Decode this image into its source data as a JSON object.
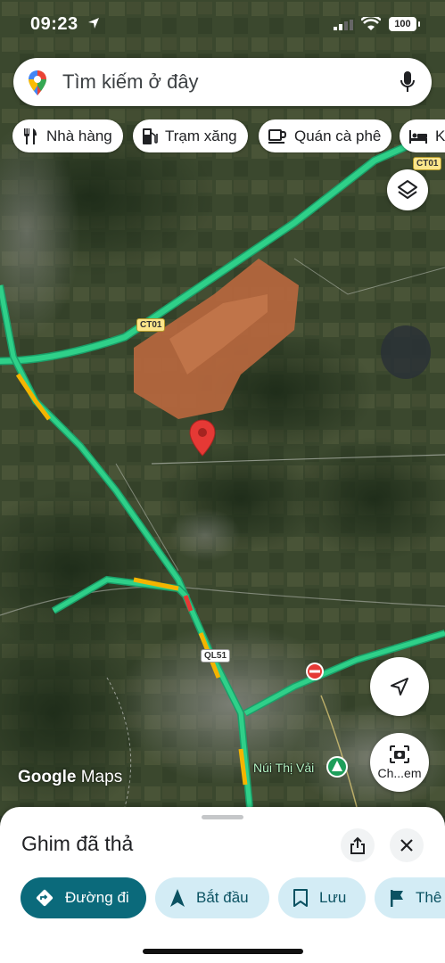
{
  "status_bar": {
    "time": "09:23",
    "battery": "100"
  },
  "search": {
    "placeholder": "Tìm kiếm ở đây"
  },
  "chips": [
    {
      "label": "Nhà hàng",
      "icon": "restaurant-icon"
    },
    {
      "label": "Trạm xăng",
      "icon": "gas-station-icon"
    },
    {
      "label": "Quán cà phê",
      "icon": "coffee-icon"
    },
    {
      "label": "Kh",
      "icon": "hotel-icon"
    }
  ],
  "map": {
    "road_labels": [
      "CT01",
      "CT01",
      "QL51"
    ],
    "place_label": "Núi Thị Vải",
    "branding": {
      "google": "Google",
      "maps": "Maps"
    },
    "street_view_label": "Ch...em"
  },
  "sheet": {
    "title": "Ghim đã thả",
    "actions": [
      {
        "label": "Đường đi",
        "icon": "directions-icon"
      },
      {
        "label": "Bắt đầu",
        "icon": "navigation-icon"
      },
      {
        "label": "Lưu",
        "icon": "bookmark-icon"
      },
      {
        "label": "Thê",
        "icon": "flag-icon"
      }
    ]
  },
  "colors": {
    "highway": "#2fd089",
    "traffic_slow": "#f4b400",
    "traffic_jam": "#e53935",
    "pin": "#e53935",
    "primary_action": "#0b6a7b",
    "secondary_action": "#d3ecf5"
  }
}
